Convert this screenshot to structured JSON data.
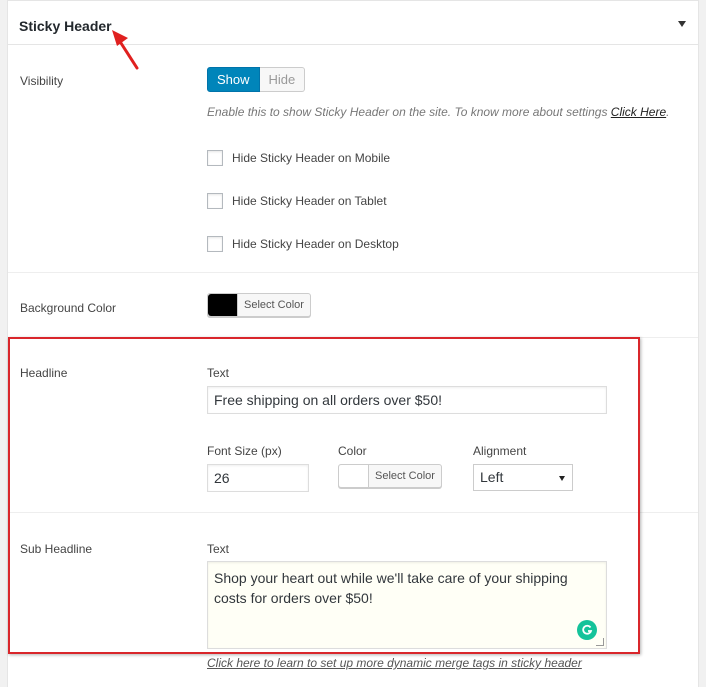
{
  "panel": {
    "title": "Sticky Header"
  },
  "visibility": {
    "label": "Visibility",
    "show_label": "Show",
    "hide_label": "Hide",
    "help_text": "Enable this to show Sticky Header on the site. To know more about settings",
    "help_link": "Click Here",
    "help_suffix": ".",
    "checkboxes": [
      {
        "label": "Hide Sticky Header on Mobile",
        "checked": false
      },
      {
        "label": "Hide Sticky Header on Tablet",
        "checked": false
      },
      {
        "label": "Hide Sticky Header on Desktop",
        "checked": false
      }
    ]
  },
  "background": {
    "label": "Background Color",
    "button_label": "Select Color",
    "color": "#000000"
  },
  "headline": {
    "label": "Headline",
    "text_label": "Text",
    "text_value": "Free shipping on all orders over $50!",
    "font_size_label": "Font Size (px)",
    "font_size_value": "26",
    "color_label": "Color",
    "color_button_label": "Select Color",
    "color": "#ffffff",
    "alignment_label": "Alignment",
    "alignment_value": "Left"
  },
  "sub_headline": {
    "label": "Sub Headline",
    "text_label": "Text",
    "text_value": "Shop your heart out while we'll take care of your shipping costs for orders over $50!",
    "merge_tags_link": "Click here to learn to set up more dynamic merge tags in sticky header"
  },
  "colors": {
    "accent": "#0085ba",
    "highlight": "#d9262b",
    "grammarly": "#15c39a"
  }
}
